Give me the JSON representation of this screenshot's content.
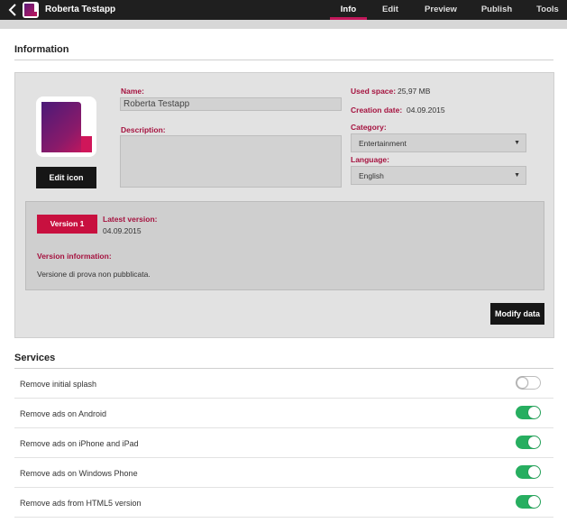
{
  "topbar": {
    "app_title": "Roberta Testapp",
    "nav": [
      {
        "label": "Info",
        "active": true
      },
      {
        "label": "Edit",
        "active": false
      },
      {
        "label": "Preview",
        "active": false
      },
      {
        "label": "Publish",
        "active": false
      },
      {
        "label": "Tools",
        "active": false
      }
    ]
  },
  "info": {
    "section_title": "Information",
    "edit_icon_label": "Edit icon",
    "name_label": "Name:",
    "name_value": "Roberta Testapp",
    "description_label": "Description:",
    "description_value": "",
    "used_space_label": "Used space:",
    "used_space_value": "25,97 MB",
    "creation_date_label": "Creation date:",
    "creation_date_value": "04.09.2015",
    "category_label": "Category:",
    "category_value": "Entertainment",
    "language_label": "Language:",
    "language_value": "English",
    "version": {
      "badge": "Version 1",
      "latest_label": "Latest version:",
      "latest_date": "04.09.2015",
      "info_label": "Version information:",
      "info_text": "Versione di prova non pubblicata."
    },
    "modify_label": "Modify data"
  },
  "services": {
    "section_title": "Services",
    "items": [
      {
        "label": "Remove initial splash",
        "enabled": false
      },
      {
        "label": "Remove ads on Android",
        "enabled": true
      },
      {
        "label": "Remove ads on iPhone and iPad",
        "enabled": true
      },
      {
        "label": "Remove ads on Windows Phone",
        "enabled": true
      },
      {
        "label": "Remove ads from HTML5 version",
        "enabled": true
      }
    ]
  },
  "colors": {
    "accent": "#c8103f",
    "toggle_on": "#27ae60",
    "topbar": "#1f1f1f"
  },
  "icons": {
    "back": "chevron-left-icon",
    "app": "app-logo-icon"
  }
}
